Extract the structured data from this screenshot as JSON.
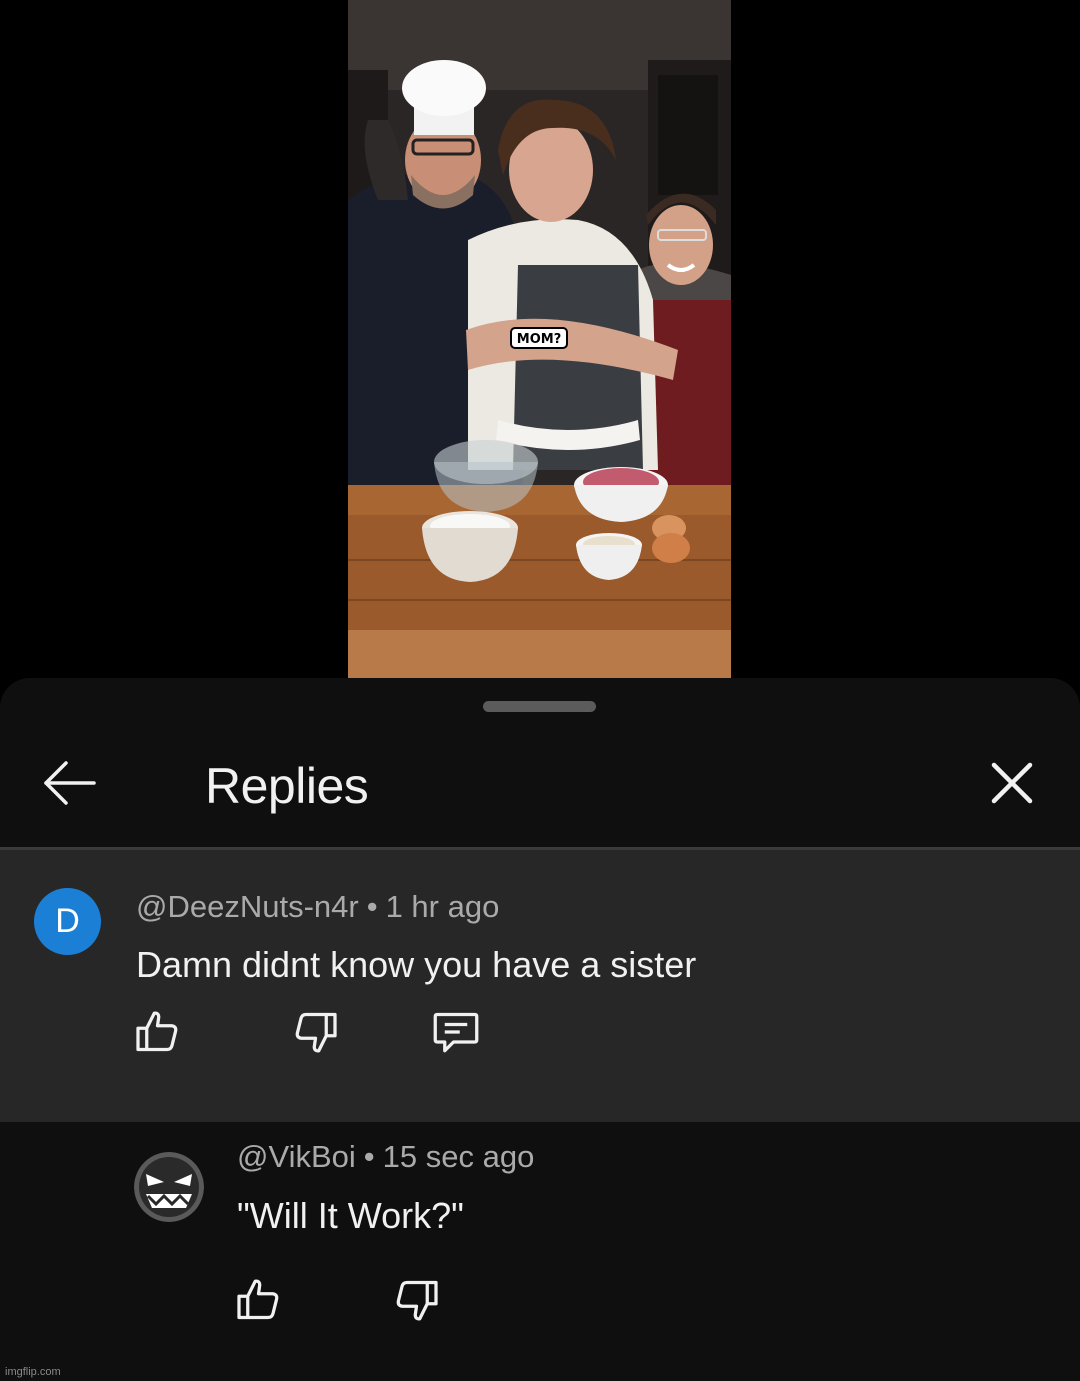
{
  "video": {
    "caption": "MOM?"
  },
  "sheet": {
    "title": "Replies",
    "back_icon": "arrow-left-icon",
    "close_icon": "close-icon"
  },
  "parent_comment": {
    "avatar_letter": "D",
    "avatar_color": "#1c7fd6",
    "author": "@DeezNuts-n4r",
    "separator": "•",
    "time": "1 hr ago",
    "text": "Damn didnt know you have a sister",
    "actions": [
      "thumbs-up-icon",
      "thumbs-down-icon",
      "reply-icon"
    ]
  },
  "reply": {
    "avatar_icon": "angry-face-avatar",
    "author": "@VikBoi",
    "separator": "•",
    "time": "15 sec ago",
    "text": "\"Will It Work?\"",
    "actions": [
      "thumbs-up-icon",
      "thumbs-down-icon"
    ]
  },
  "watermark": "imgflip.com",
  "colors": {
    "sheet_bg": "#0f0f0f",
    "highlight_bg": "#272727",
    "text_primary": "#f1f1f1",
    "text_secondary": "#aaaaaa"
  }
}
